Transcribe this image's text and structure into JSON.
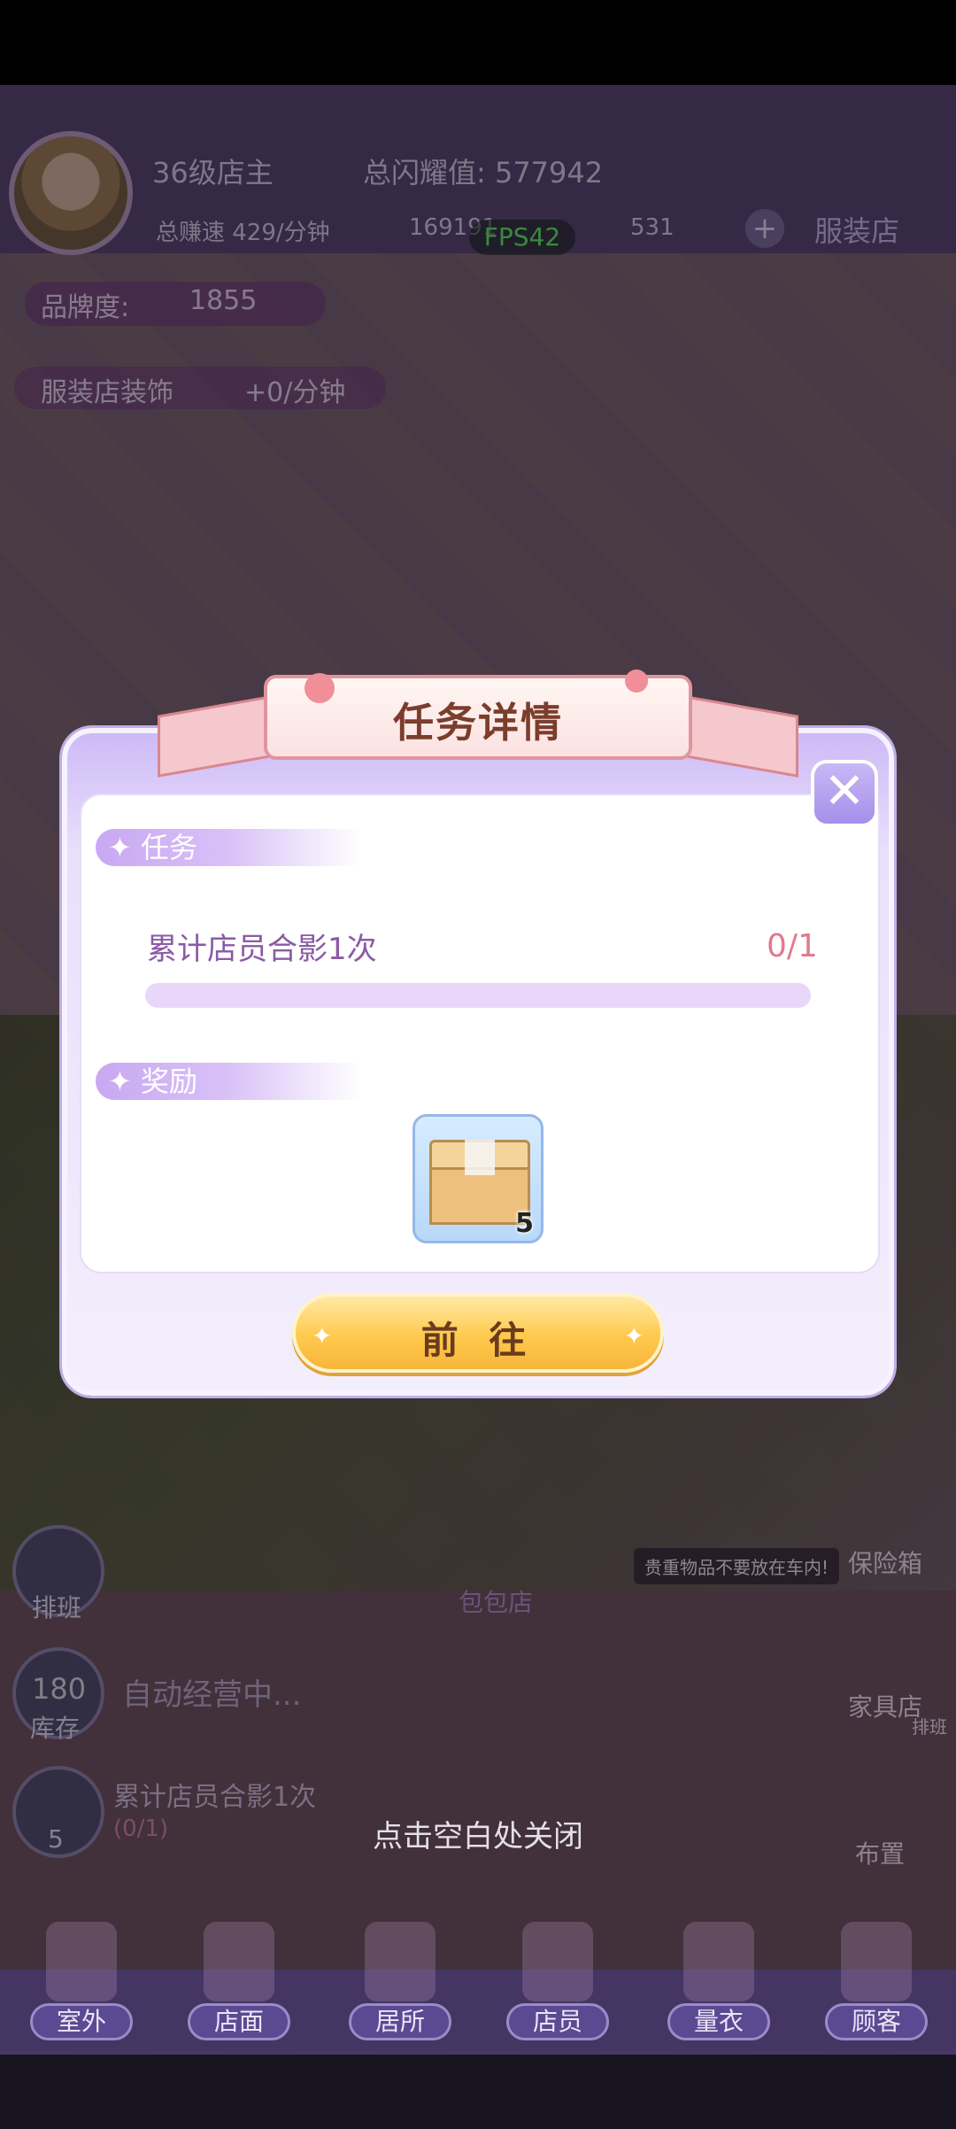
{
  "hud": {
    "level": "36级店主",
    "total_shine": "总闪耀值: 577942",
    "earn_speed": "总赚速 429/分钟",
    "cash": "169191",
    "fps": "FPS42",
    "gems": "531",
    "shop_type": "服装店",
    "brand_label": "品牌度:",
    "brand_value": "1855",
    "decor_label": "服装店装饰",
    "decor_value": "+0/分钟"
  },
  "left_panel": {
    "schedule": "排班",
    "stock_count": "180",
    "stock_label": "库存",
    "auto_status": "自动经营中...",
    "mini_task_title": "累计店员合影1次",
    "mini_task_progress": "(0/1)",
    "mini_task_count": "5"
  },
  "scene": {
    "shop_sign": "包包店",
    "tip_text": "贵重物品不要放在车内!",
    "right_buttons": [
      "保险箱",
      "家具店",
      "排班",
      "布置"
    ]
  },
  "modal": {
    "title": "任务详情",
    "task_section": "任务",
    "task_desc": "累计店员合影1次",
    "task_progress": "0/1",
    "progress_fraction": 0,
    "reward_section": "奖励",
    "reward_count": "5",
    "go_button": "前 往"
  },
  "close_hint": "点击空白处关闭",
  "nav": [
    "室外",
    "店面",
    "居所",
    "店员",
    "量衣",
    "顾客"
  ]
}
